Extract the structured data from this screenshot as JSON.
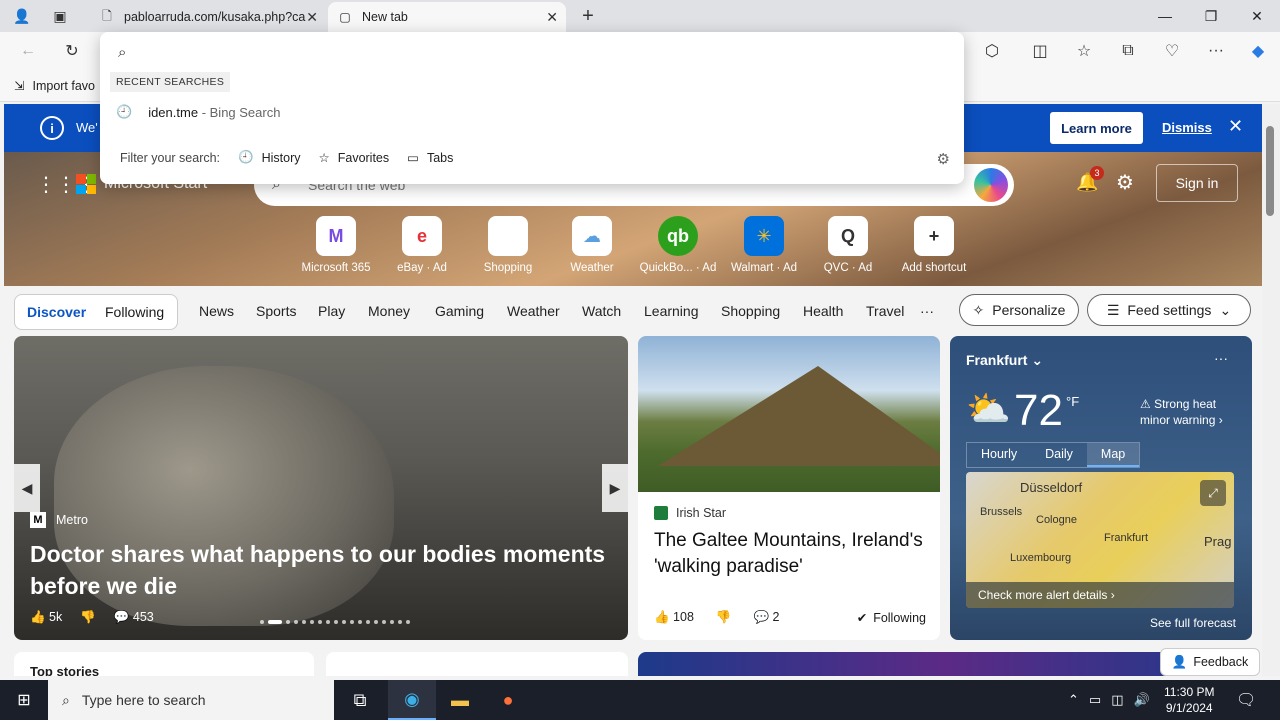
{
  "browser": {
    "tabs": [
      {
        "title": "pabloarruda.com/kusaka.php?ca",
        "active": false
      },
      {
        "title": "New tab",
        "active": true
      }
    ],
    "favorites_bar": {
      "import_label": "Import favo"
    }
  },
  "omnibox": {
    "query": "",
    "recent_header": "RECENT SEARCHES",
    "recent": [
      {
        "text": "iden.tme",
        "suffix": "- Bing Search"
      }
    ],
    "filter_label": "Filter your search:",
    "filters": [
      "History",
      "Favorites",
      "Tabs"
    ]
  },
  "banner": {
    "text": "We'",
    "learn_more": "Learn more",
    "dismiss": "Dismiss"
  },
  "header": {
    "brand": "Microsoft Start",
    "search_placeholder": "Search the web",
    "notif_count": "3",
    "sign_in": "Sign in"
  },
  "shortcuts": [
    {
      "label": "Microsoft 365",
      "icon": "M"
    },
    {
      "label": "eBay · Ad",
      "icon": "e"
    },
    {
      "label": "Shopping",
      "icon": "◇"
    },
    {
      "label": "Weather",
      "icon": "☁"
    },
    {
      "label": "QuickBo... · Ad",
      "icon": "qb"
    },
    {
      "label": "Walmart · Ad",
      "icon": "✳"
    },
    {
      "label": "QVC · Ad",
      "icon": "Q"
    },
    {
      "label": "Add shortcut",
      "icon": "+"
    }
  ],
  "nav": {
    "discover": "Discover",
    "following": "Following",
    "items": [
      "News",
      "Sports",
      "Play",
      "Money",
      "Gaming",
      "Weather",
      "Watch",
      "Learning",
      "Shopping",
      "Health",
      "Travel",
      "···"
    ],
    "personalize": "Personalize",
    "feed_settings": "Feed settings"
  },
  "main_story": {
    "source": "Metro",
    "headline": "Doctor shares what happens to our bodies moments before we die",
    "likes": "5k",
    "comments": "453"
  },
  "irish_story": {
    "source": "Irish Star",
    "headline": "The Galtee Mountains, Ireland's 'walking paradise'",
    "likes": "108",
    "comments": "2",
    "following": "Following"
  },
  "weather": {
    "city": "Frankfurt",
    "temp": "72",
    "unit": "°F",
    "alert": "Strong heat minor warning",
    "tabs": [
      "Hourly",
      "Daily",
      "Map"
    ],
    "map_labels": [
      "Düsseldorf",
      "Brussels",
      "Cologne",
      "Frankfurt",
      "Luxembourg",
      "Prag"
    ],
    "map_cta": "Check more alert details ›",
    "forecast": "See full forecast"
  },
  "bottom": {
    "top_stories": "Top stories",
    "feedback": "Feedback"
  },
  "taskbar": {
    "search_placeholder": "Type here to search",
    "time": "11:30 PM",
    "date": "9/1/2024"
  }
}
